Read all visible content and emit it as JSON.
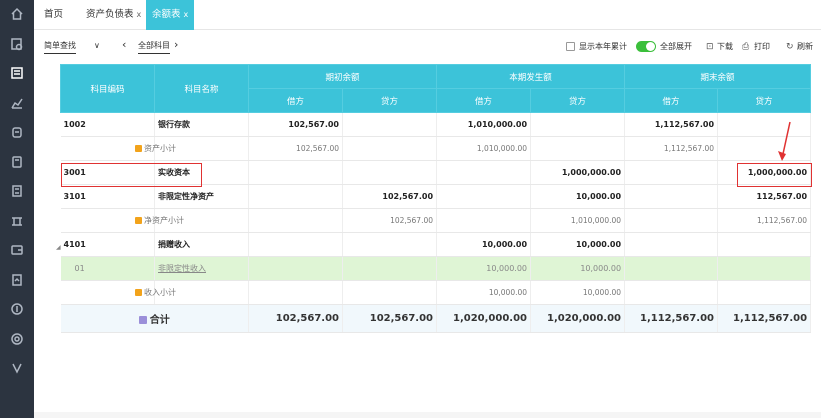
{
  "rail": [
    "home-icon",
    "search-file-icon",
    "ledger-icon",
    "chart-icon",
    "account-icon",
    "cart-icon",
    "calculator-icon",
    "bank-icon",
    "wallet-icon",
    "report-icon",
    "pay-icon",
    "settings-icon",
    "v-icon"
  ],
  "tabs": [
    {
      "label": "首页",
      "closable": false
    },
    {
      "label": "资产负债表",
      "closable": true
    },
    {
      "label": "余额表",
      "closable": true,
      "active": true
    }
  ],
  "tab_close": "x",
  "toolbar": {
    "query": "简单查找",
    "query_arrow": "∨",
    "prev": "‹",
    "next": "›",
    "all_subjects": "全部科目",
    "show_ytd": "显示本年累计",
    "expand_all": "全部展开",
    "download": "下载",
    "print": "打印",
    "refresh": "刷新"
  },
  "table": {
    "col_code": "科目编码",
    "col_name": "科目名称",
    "group_opening": "期初余额",
    "group_current": "本期发生额",
    "group_closing": "期末余额",
    "debit": "借方",
    "credit": "贷方",
    "rows": [
      {
        "type": "bold",
        "code": "1002",
        "name": "银行存款",
        "v": [
          "102,567.00",
          "",
          "1,010,000.00",
          "",
          "1,112,567.00",
          ""
        ]
      },
      {
        "type": "sub",
        "code": "",
        "name": "资产小计",
        "v": [
          "102,567.00",
          "",
          "1,010,000.00",
          "",
          "1,112,567.00",
          ""
        ]
      },
      {
        "type": "bold",
        "code": "3001",
        "name": "实收资本",
        "v": [
          "",
          "",
          "",
          "1,000,000.00",
          "",
          "1,000,000.00"
        ]
      },
      {
        "type": "bold",
        "code": "3101",
        "name": "非限定性净资产",
        "v": [
          "",
          "102,567.00",
          "",
          "10,000.00",
          "",
          "112,567.00"
        ]
      },
      {
        "type": "sub",
        "code": "",
        "name": "净资产小计",
        "v": [
          "",
          "102,567.00",
          "",
          "1,010,000.00",
          "",
          "1,112,567.00"
        ]
      },
      {
        "type": "bold",
        "code": "4101",
        "name": "捐赠收入",
        "v": [
          "",
          "",
          "10,000.00",
          "10,000.00",
          "",
          ""
        ]
      },
      {
        "type": "green",
        "code": "01",
        "name": "非限定性收入",
        "v": [
          "",
          "",
          "10,000.00",
          "10,000.00",
          "",
          ""
        ]
      },
      {
        "type": "sub",
        "code": "",
        "name": "收入小计",
        "v": [
          "",
          "",
          "10,000.00",
          "10,000.00",
          "",
          ""
        ]
      }
    ],
    "total": {
      "name": "合计",
      "v": [
        "102,567.00",
        "102,567.00",
        "1,020,000.00",
        "1,020,000.00",
        "1,112,567.00",
        "1,112,567.00"
      ]
    }
  },
  "colors": {
    "header": "#3cc3d9",
    "highlight": "#e03232",
    "toggle": "#3bbf3b",
    "rail": "#2c3440"
  }
}
